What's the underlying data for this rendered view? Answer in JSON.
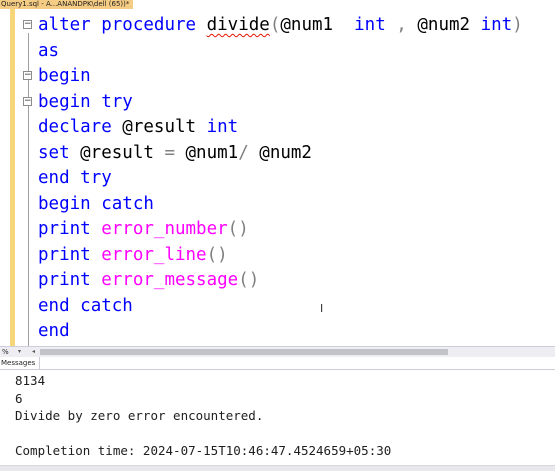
{
  "window": {
    "tab_title": "Query1.sql - A...ANANDPK\\dell (65))*"
  },
  "editor": {
    "lines": [
      [
        {
          "t": "alter",
          "c": "kw"
        },
        {
          "t": " ",
          "c": "tx"
        },
        {
          "t": "procedure",
          "c": "kw"
        },
        {
          "t": " ",
          "c": "tx"
        },
        {
          "t": "divide",
          "c": "tx",
          "err": true
        },
        {
          "t": "(",
          "c": "gr"
        },
        {
          "t": "@num1  ",
          "c": "tx"
        },
        {
          "t": "int",
          "c": "kw"
        },
        {
          "t": " ",
          "c": "tx"
        },
        {
          "t": ",",
          "c": "gr"
        },
        {
          "t": " @num2 ",
          "c": "tx"
        },
        {
          "t": "int",
          "c": "kw"
        },
        {
          "t": ")",
          "c": "gr"
        }
      ],
      [
        {
          "t": "as",
          "c": "kw"
        }
      ],
      [
        {
          "t": "begin",
          "c": "kw"
        }
      ],
      [
        {
          "t": "begin",
          "c": "kw"
        },
        {
          "t": " ",
          "c": "tx"
        },
        {
          "t": "try",
          "c": "kw"
        }
      ],
      [
        {
          "t": "declare",
          "c": "kw"
        },
        {
          "t": " @result ",
          "c": "tx"
        },
        {
          "t": "int",
          "c": "kw"
        }
      ],
      [
        {
          "t": "set",
          "c": "kw"
        },
        {
          "t": " @result ",
          "c": "tx"
        },
        {
          "t": "=",
          "c": "gr"
        },
        {
          "t": " @num1",
          "c": "tx"
        },
        {
          "t": "/",
          "c": "gr"
        },
        {
          "t": " @num2",
          "c": "tx"
        }
      ],
      [
        {
          "t": "end",
          "c": "kw"
        },
        {
          "t": " ",
          "c": "tx"
        },
        {
          "t": "try",
          "c": "kw"
        }
      ],
      [
        {
          "t": "begin",
          "c": "kw"
        },
        {
          "t": " ",
          "c": "tx"
        },
        {
          "t": "catch",
          "c": "kw"
        }
      ],
      [
        {
          "t": "print",
          "c": "kw"
        },
        {
          "t": " ",
          "c": "tx"
        },
        {
          "t": "error_number",
          "c": "fn"
        },
        {
          "t": "()",
          "c": "gr"
        }
      ],
      [
        {
          "t": "print",
          "c": "kw"
        },
        {
          "t": " ",
          "c": "tx"
        },
        {
          "t": "error_line",
          "c": "fn"
        },
        {
          "t": "()",
          "c": "gr"
        }
      ],
      [
        {
          "t": "print",
          "c": "kw"
        },
        {
          "t": " ",
          "c": "tx"
        },
        {
          "t": "error_message",
          "c": "fn"
        },
        {
          "t": "()",
          "c": "gr"
        }
      ],
      [
        {
          "t": "end",
          "c": "kw"
        },
        {
          "t": " ",
          "c": "tx"
        },
        {
          "t": "catch",
          "c": "kw"
        }
      ],
      [
        {
          "t": "end",
          "c": "kw"
        }
      ]
    ],
    "collapse_glyph": "−"
  },
  "statusbar": {
    "zoom": "%",
    "zoom_arrow": "▾",
    "scroll_left": "◂"
  },
  "results": {
    "tab_label": "Messages",
    "lines": [
      "8134",
      "6",
      "Divide by zero error encountered.",
      "",
      "Completion time: 2024-07-15T10:46:47.4524659+05:30"
    ]
  },
  "colors": {
    "keyword": "#0000ff",
    "function": "#ff00ff",
    "operator": "#808080",
    "error_squiggle": "#e51400",
    "tab_active": "#f5cc84"
  },
  "icons": {
    "text_cursor": "I"
  }
}
